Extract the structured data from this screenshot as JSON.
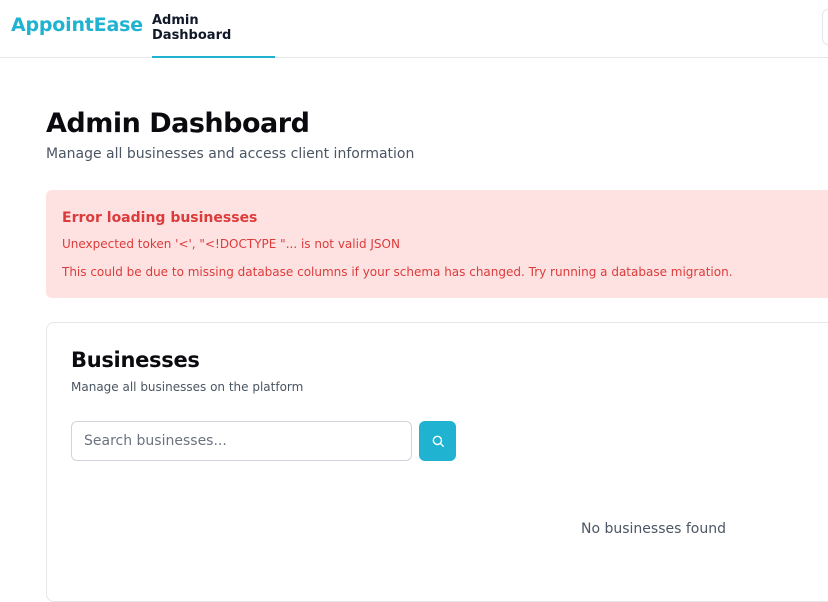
{
  "app": {
    "brand": "AppointEase"
  },
  "nav": {
    "tabs": [
      {
        "label": "Admin Dashboard",
        "active": true
      }
    ]
  },
  "header": {
    "title": "Admin Dashboard",
    "subtitle": "Manage all businesses and access client information"
  },
  "error": {
    "title": "Error loading businesses",
    "message": "Unexpected token '<', \"<!DOCTYPE \"... is not valid JSON",
    "hint": "This could be due to missing database columns if your schema has changed. Try running a database migration."
  },
  "businesses": {
    "title": "Businesses",
    "subtitle": "Manage all businesses on the platform",
    "search": {
      "placeholder": "Search businesses...",
      "value": "",
      "button_icon": "search-icon"
    },
    "empty_message": "No businesses found"
  },
  "colors": {
    "accent": "#1fb3d1",
    "error_bg": "#fee2e2",
    "error_text": "#dc3b3b"
  }
}
